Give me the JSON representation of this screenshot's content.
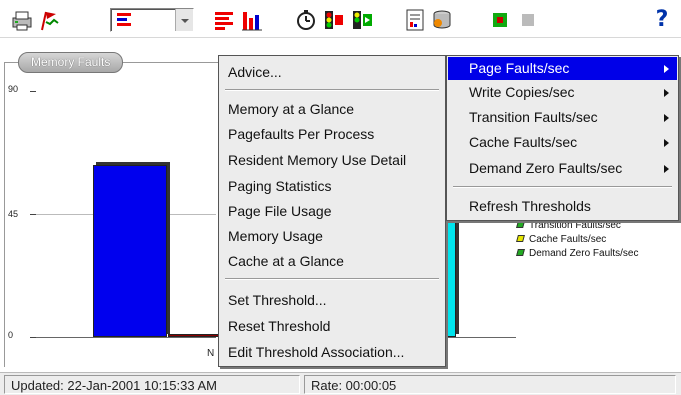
{
  "toolbar": {
    "buttons": [
      "print-icon",
      "chart-flag-icon",
      "chart-type-combo",
      "bar-chart-red-icon",
      "column-chart-icon",
      "stopwatch-icon",
      "traffic-light-icon",
      "data-view-icon",
      "report-icon",
      "database-icon",
      "record-green-icon",
      "stop-gray-icon",
      "help-icon"
    ],
    "help_label": "?"
  },
  "chart": {
    "title": "Memory Faults",
    "yticks": [
      "90",
      "45",
      "0"
    ],
    "x_label_fragment": "N",
    "chart_data": {
      "type": "bar",
      "ylim": [
        0,
        90
      ],
      "series": [
        {
          "name": "Page Faults/sec",
          "color": "#0000ee",
          "value": 63
        },
        {
          "name": "Write Copies/sec",
          "color": "#8b0000",
          "value": 1
        },
        {
          "name": "Transition Faults/sec",
          "color": "#22aa22",
          "value": 0
        },
        {
          "name": "Cache Faults/sec",
          "color": "#e6e600",
          "value": 0
        },
        {
          "name": "Demand Zero Faults/sec",
          "color": "#00e5ee",
          "value": 79
        }
      ]
    },
    "legend_visible": [
      "Transition Faults/sec",
      "Cache Faults/sec",
      "Demand Zero Faults/sec"
    ]
  },
  "context_menu": {
    "items": [
      "Advice...",
      "Memory at a Glance",
      "Pagefaults Per Process",
      "Resident Memory Use Detail",
      "Paging Statistics",
      "Page File Usage",
      "Memory Usage",
      "Cache at a Glance",
      "Set Threshold...",
      "Reset Threshold",
      "Edit Threshold Association..."
    ]
  },
  "submenu": {
    "items": [
      "Page Faults/sec",
      "Write Copies/sec",
      "Transition Faults/sec",
      "Cache Faults/sec",
      "Demand Zero Faults/sec",
      "Refresh Thresholds"
    ],
    "selected": "Page Faults/sec",
    "highlight_color": "#0000e8"
  },
  "status": {
    "updated": "Updated: 22-Jan-2001 10:15:33 AM",
    "rate": "Rate: 00:00:05"
  }
}
